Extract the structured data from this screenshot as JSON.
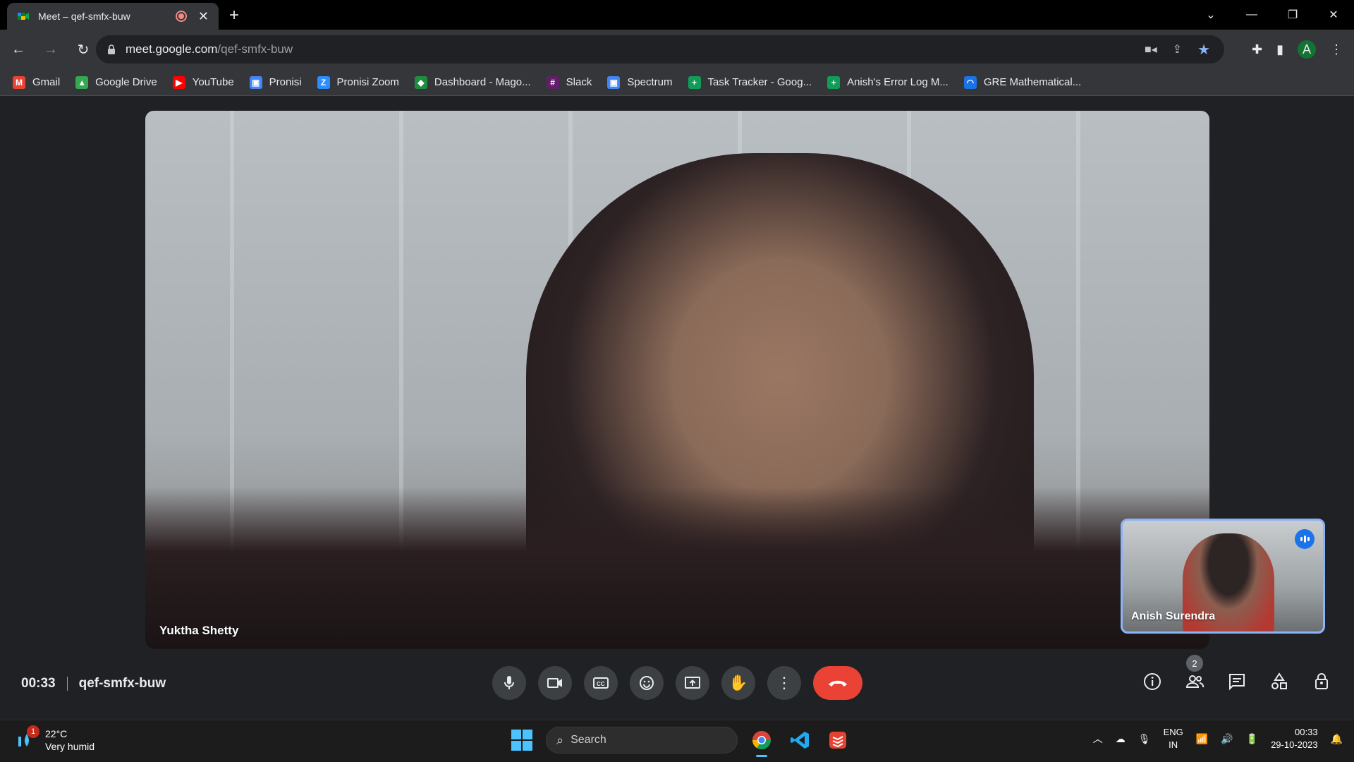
{
  "browser": {
    "tab_title": "Meet – qef-smfx-buw",
    "url_host": "meet.google.com",
    "url_path": "/qef-smfx-buw",
    "profile_initial": "A"
  },
  "bookmarks": [
    {
      "label": "Gmail",
      "icon": "gmail-icon",
      "color": "#ea4335",
      "glyph": "M"
    },
    {
      "label": "Google Drive",
      "icon": "drive-icon",
      "color": "#34a853",
      "glyph": "▲"
    },
    {
      "label": "YouTube",
      "icon": "youtube-icon",
      "color": "#ff0000",
      "glyph": "▶"
    },
    {
      "label": "Pronisi",
      "icon": "pronisi-icon",
      "color": "#4285f4",
      "glyph": "▣"
    },
    {
      "label": "Pronisi Zoom",
      "icon": "zoom-icon",
      "color": "#2d8cff",
      "glyph": "Z"
    },
    {
      "label": "Dashboard - Mago...",
      "icon": "dashboard-icon",
      "color": "#1e8e3e",
      "glyph": "◆"
    },
    {
      "label": "Slack",
      "icon": "slack-icon",
      "color": "#611f69",
      "glyph": "#"
    },
    {
      "label": "Spectrum",
      "icon": "spectrum-icon",
      "color": "#4285f4",
      "glyph": "▣"
    },
    {
      "label": "Task Tracker - Goog...",
      "icon": "sheets-icon",
      "color": "#0f9d58",
      "glyph": "+"
    },
    {
      "label": "Anish's Error Log M...",
      "icon": "sheets-icon",
      "color": "#0f9d58",
      "glyph": "+"
    },
    {
      "label": "GRE Mathematical...",
      "icon": "loading-icon",
      "color": "#1a73e8",
      "glyph": "◠"
    }
  ],
  "meet": {
    "main_participant": "Yuktha Shetty",
    "self_participant": "Anish Surendra",
    "time": "00:33",
    "meeting_code": "qef-smfx-buw",
    "people_count": "2"
  },
  "taskbar": {
    "weather_badge": "1",
    "temperature": "22°C",
    "weather_desc": "Very humid",
    "search_placeholder": "Search",
    "lang_line1": "ENG",
    "lang_line2": "IN",
    "clock_time": "00:33",
    "clock_date": "29-10-2023"
  }
}
